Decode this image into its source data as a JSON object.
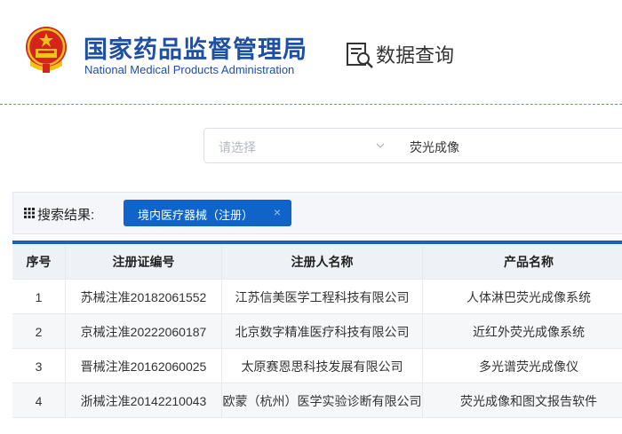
{
  "header": {
    "org_name_cn": "国家药品监督管理局",
    "org_name_en": "National Medical Products Administration",
    "emblem_icon": "national-emblem-icon",
    "query_icon": "document-search-icon",
    "query_title": "数据查询"
  },
  "search": {
    "select_placeholder": "请选择",
    "select_icon": "chevron-down-icon",
    "query_value": "荧光成像"
  },
  "results": {
    "label": "搜索结果:",
    "grid_icon": "grid-icon",
    "tag_label": "境内医疗器械（注册）",
    "tag_close": "×"
  },
  "table": {
    "headers": [
      "序号",
      "注册证编号",
      "注册人名称",
      "产品名称"
    ],
    "rows": [
      [
        "1",
        "苏械注准20182061552",
        "江苏信美医学工程科技有限公司",
        "人体淋巴荧光成像系统"
      ],
      [
        "2",
        "京械注准20222060187",
        "北京数字精准医疗科技有限公司",
        "近红外荧光成像系统"
      ],
      [
        "3",
        "晋械注准20162060025",
        "太原赛恩思科技发展有限公司",
        "多光谱荧光成像仪"
      ],
      [
        "4",
        "浙械注准20142210043",
        "欧蒙（杭州）医学实验诊断有限公司",
        "荧光成像和图文报告软件"
      ]
    ]
  },
  "colors": {
    "brand_blue": "#1f4fa2",
    "tag_blue": "#1063c9",
    "table_rule": "#1f5fb6"
  }
}
